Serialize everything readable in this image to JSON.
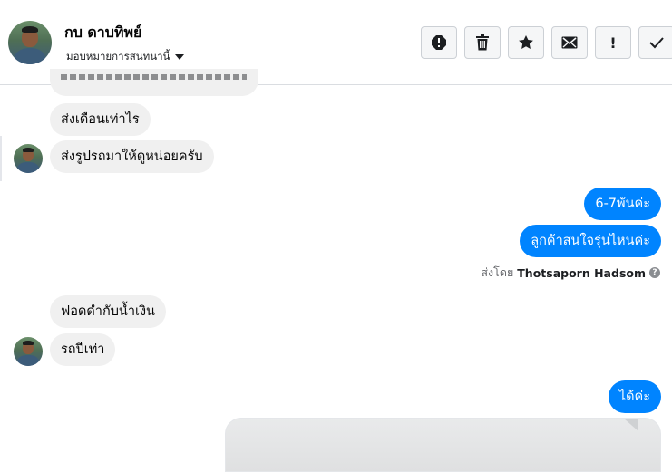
{
  "header": {
    "contact_name": "กบ ดาบทิพย์",
    "assign_label": "มอบหมายการสนทนานี้"
  },
  "toolbar": [
    {
      "name": "spam-button",
      "icon": "alert-circle-icon"
    },
    {
      "name": "delete-button",
      "icon": "trash-icon"
    },
    {
      "name": "star-button",
      "icon": "star-icon"
    },
    {
      "name": "mark-unread-button",
      "icon": "envelope-icon"
    },
    {
      "name": "follow-up-button",
      "icon": "exclamation-icon",
      "glyph": "!"
    },
    {
      "name": "mark-done-button",
      "icon": "check-icon"
    }
  ],
  "messages": {
    "m1": "ส่งเดือนเท่าไร",
    "m2": "ส่งรูปรถมาให้ดูหน่อยครับ",
    "m3": "6-7พันค่ะ",
    "m4": "ลูกค้าสนใจรุ่นไหนค่ะ",
    "m5": "ฟอดดำกับน้ำเงิน",
    "m6": "รถปีเท่า",
    "m7": "ได้ค่ะ"
  },
  "sent_by": {
    "prefix": "ส่งโดย",
    "name": "Thotsaporn Hadsom"
  },
  "colors": {
    "outgoing_bubble": "#0084ff",
    "incoming_bubble": "#f0f0f0"
  }
}
